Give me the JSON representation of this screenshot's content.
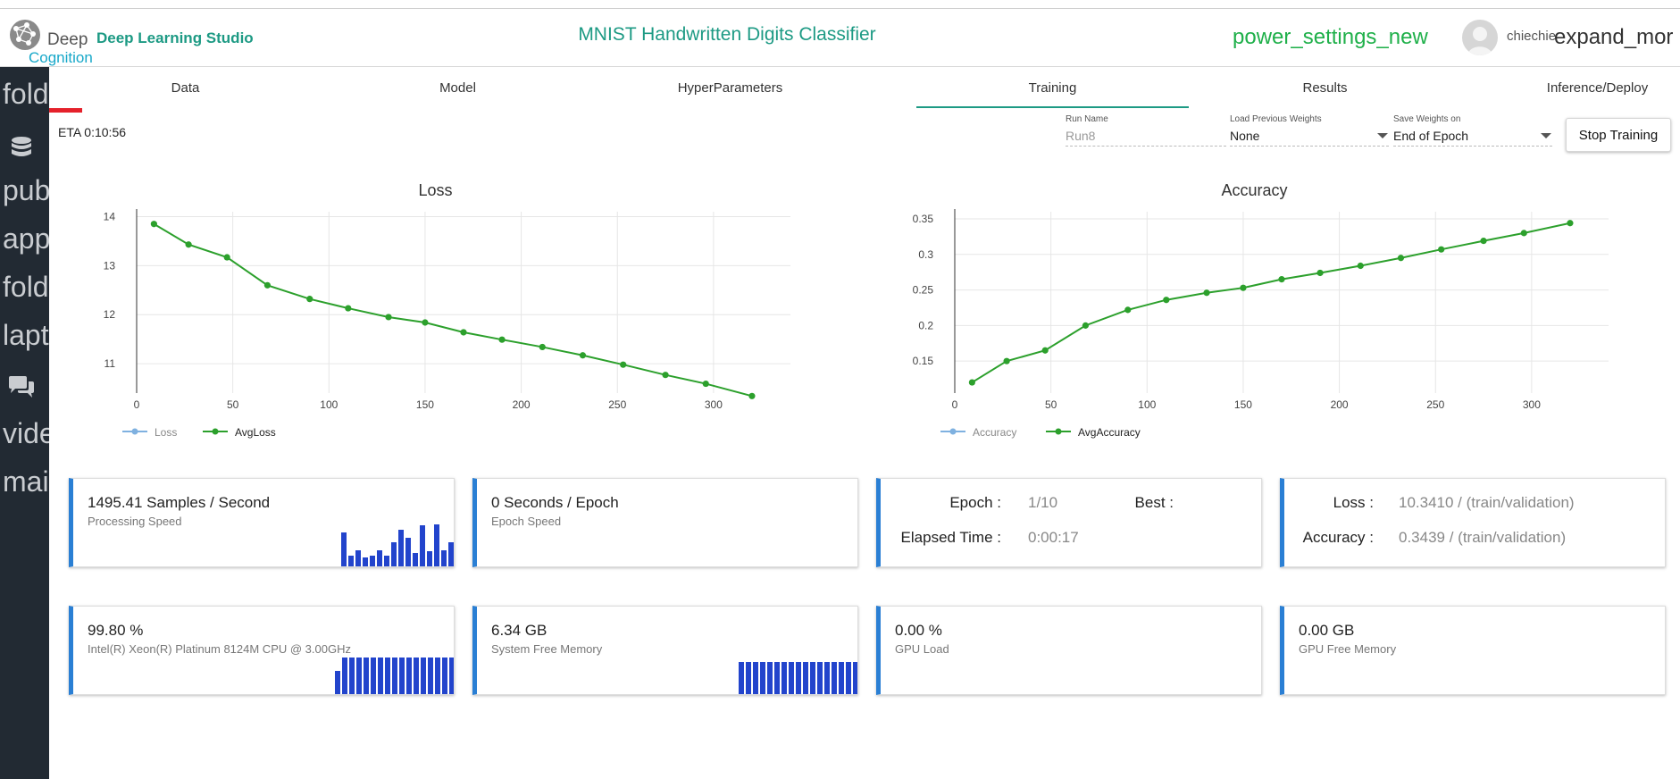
{
  "header": {
    "logo_deep": "Deep",
    "logo_cognition": "Cognition",
    "studio": "Deep Learning Studio",
    "app_title": "MNIST Handwritten Digits Classifier",
    "power_icon_text": "power_settings_new",
    "username": "chiechie",
    "expand_icon_text": "expand_mor"
  },
  "sidebar": {
    "items": [
      {
        "label": "fold",
        "icon": "folder-icon"
      },
      {
        "label": "",
        "icon": "database-icon"
      },
      {
        "label": "pub",
        "icon": "public-icon"
      },
      {
        "label": "app",
        "icon": "apps-icon"
      },
      {
        "label": "fold",
        "icon": "folder-icon"
      },
      {
        "label": "lapt",
        "icon": "laptop-icon"
      },
      {
        "label": "",
        "icon": "chat-icon"
      },
      {
        "label": "vide",
        "icon": "video-icon"
      },
      {
        "label": "mai",
        "icon": "mail-icon"
      }
    ]
  },
  "tabs": [
    {
      "label": "Data"
    },
    {
      "label": "Model"
    },
    {
      "label": "HyperParameters"
    },
    {
      "label": "Training",
      "active": true
    },
    {
      "label": "Results"
    },
    {
      "label": "Inference/Deploy"
    }
  ],
  "toolbar": {
    "eta": "ETA 0:10:56",
    "run_name_label": "Run Name",
    "run_name_value": "Run8",
    "load_weights_label": "Load Previous Weights",
    "load_weights_value": "None",
    "save_weights_label": "Save Weights on",
    "save_weights_value": "End of Epoch",
    "stop_button": "Stop Training"
  },
  "colors": {
    "accent": "#1d9a84",
    "series_line": "#2ca02c",
    "loss_legend": "#7fb1e0",
    "card_border": "#2a7fd4",
    "mini_bar": "#2244cc",
    "sidebar": "#222a33",
    "tab_highlight": "#e5212b"
  },
  "chart_data": [
    {
      "type": "line",
      "title": "Loss",
      "xlim": [
        0,
        340
      ],
      "ylim": [
        10.4,
        14.1
      ],
      "x_ticks": [
        0,
        50,
        100,
        150,
        200,
        250,
        300
      ],
      "y_ticks": [
        11,
        12,
        13,
        14
      ],
      "grid": true,
      "legend": "bottom-left",
      "series": [
        {
          "name": "Loss",
          "x": [],
          "y": []
        },
        {
          "name": "AvgLoss",
          "x": [
            9,
            27,
            47,
            68,
            90,
            110,
            131,
            150,
            170,
            190,
            211,
            232,
            253,
            275,
            296,
            320
          ],
          "y": [
            13.85,
            13.43,
            13.17,
            12.6,
            12.32,
            12.13,
            11.95,
            11.84,
            11.64,
            11.49,
            11.34,
            11.17,
            10.98,
            10.77,
            10.59,
            10.34
          ]
        }
      ]
    },
    {
      "type": "line",
      "title": "Accuracy",
      "xlim": [
        0,
        340
      ],
      "ylim": [
        0.105,
        0.36
      ],
      "x_ticks": [
        0,
        50,
        100,
        150,
        200,
        250,
        300
      ],
      "y_ticks": [
        0.15,
        0.2,
        0.25,
        0.3,
        0.35
      ],
      "y_tick_labels": [
        "0.15",
        "0.2",
        "0.25",
        "0.3",
        "0.35"
      ],
      "grid": true,
      "legend": "bottom-left",
      "series": [
        {
          "name": "Accuracy",
          "x": [],
          "y": []
        },
        {
          "name": "AvgAccuracy",
          "x": [
            9,
            27,
            47,
            68,
            90,
            110,
            131,
            150,
            170,
            190,
            211,
            232,
            253,
            275,
            296,
            320
          ],
          "y": [
            0.12,
            0.15,
            0.165,
            0.2,
            0.222,
            0.236,
            0.246,
            0.253,
            0.265,
            0.274,
            0.284,
            0.295,
            0.307,
            0.319,
            0.33,
            0.344
          ]
        }
      ]
    }
  ],
  "cards": {
    "samples": {
      "value": "1495.41 Samples / Second",
      "sub": "Processing Speed",
      "bars": [
        0.8,
        0.24,
        0.37,
        0.21,
        0.24,
        0.37,
        0.24,
        0.56,
        0.85,
        0.66,
        0.32,
        0.95,
        0.35,
        0.98,
        0.37,
        0.56
      ]
    },
    "epoch_speed": {
      "value": "0 Seconds / Epoch",
      "sub": "Epoch Speed"
    },
    "epoch": {
      "epoch_label": "Epoch :",
      "epoch_value": "1/10",
      "best_label": "Best :",
      "best_value": "",
      "elapsed_label": "Elapsed Time :",
      "elapsed_value": "0:00:17"
    },
    "metrics": {
      "loss_label": "Loss :",
      "loss_value": "10.3410 / (train/validation)",
      "accuracy_label": "Accuracy :",
      "accuracy_value": "0.3439 / (train/validation)"
    },
    "cpu": {
      "value": "99.80 %",
      "sub": "Intel(R) Xeon(R) Platinum 8124M CPU @ 3.00GHz",
      "bars": [
        0.61,
        0.98,
        0.98,
        0.98,
        0.98,
        0.98,
        0.98,
        0.98,
        0.98,
        0.98,
        0.98,
        0.98,
        0.98,
        0.98,
        0.98,
        0.98,
        0.98
      ]
    },
    "memory": {
      "value": "6.34 GB",
      "sub": "System Free Memory",
      "bars": [
        0.95,
        0.95,
        0.95,
        0.95,
        0.95,
        0.95,
        0.95,
        0.95,
        0.95,
        0.95,
        0.95,
        0.95,
        0.95,
        0.95,
        0.95,
        0.95,
        0.95
      ]
    },
    "gpu_load": {
      "value": "0.00 %",
      "sub": "GPU Load"
    },
    "gpu_memory": {
      "value": "0.00 GB",
      "sub": "GPU Free Memory"
    }
  }
}
